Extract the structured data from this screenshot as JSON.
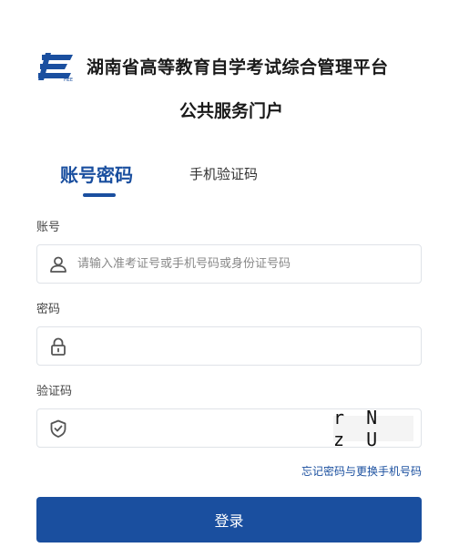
{
  "header": {
    "title_line1": "湖南省高等教育自学考试综合管理平台",
    "title_line2": "公共服务门户",
    "logo_icon": "exam-authority-logo",
    "brand_color": "#1a4f9f"
  },
  "tabs": [
    {
      "label": "账号密码",
      "active": true
    },
    {
      "label": "手机验证码",
      "active": false
    }
  ],
  "form": {
    "account": {
      "label": "账号",
      "placeholder": "请输入准考证号或手机号码或身份证号码",
      "value": "",
      "icon": "user-icon"
    },
    "password": {
      "label": "密码",
      "placeholder": "",
      "value": "",
      "icon": "lock-icon"
    },
    "captcha": {
      "label": "验证码",
      "placeholder": "",
      "value": "",
      "icon": "shield-check-icon",
      "image_text": "r N z U"
    }
  },
  "forgot_link": "忘记密码与更换手机号码",
  "login_button": "登录"
}
